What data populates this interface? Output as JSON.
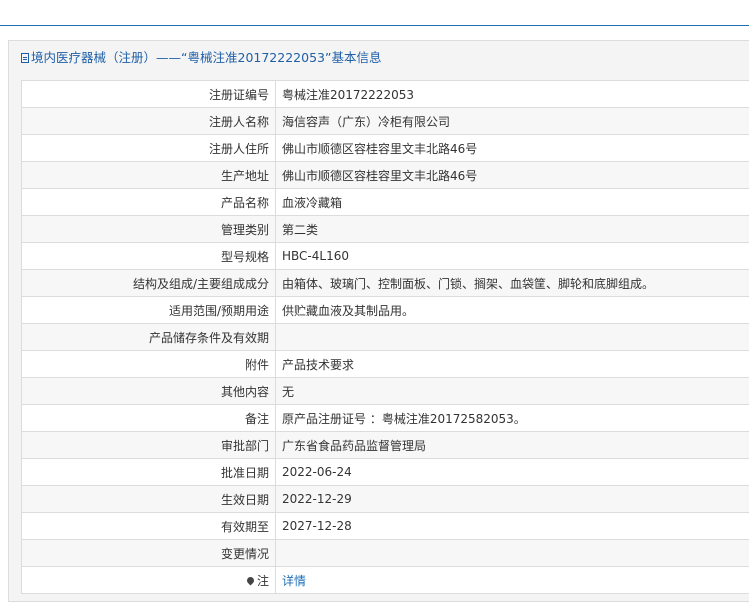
{
  "header": {
    "title_prefix": "境内医疗器械（注册）——",
    "title_main": "“粤械注准20172222053”基本信息"
  },
  "rows": [
    {
      "label": "注册证编号",
      "value": "粤械注准20172222053"
    },
    {
      "label": "注册人名称",
      "value": "海信容声（广东）冷柜有限公司"
    },
    {
      "label": "注册人住所",
      "value": "佛山市顺德区容桂容里文丰北路46号"
    },
    {
      "label": "生产地址",
      "value": "佛山市顺德区容桂容里文丰北路46号"
    },
    {
      "label": "产品名称",
      "value": "血液冷藏箱"
    },
    {
      "label": "管理类别",
      "value": "第二类"
    },
    {
      "label": "型号规格",
      "value": "HBC-4L160"
    },
    {
      "label": "结构及组成/主要组成成分",
      "value": "由箱体、玻璃门、控制面板、门锁、搁架、血袋筐、脚轮和底脚组成。"
    },
    {
      "label": "适用范围/预期用途",
      "value": "供贮藏血液及其制品用。"
    },
    {
      "label": "产品储存条件及有效期",
      "value": ""
    },
    {
      "label": "附件",
      "value": "产品技术要求"
    },
    {
      "label": "其他内容",
      "value": "无"
    },
    {
      "label": "备注",
      "value": "原产品注册证号 ：粤械注准20172582053。"
    },
    {
      "label": "审批部门",
      "value": "广东省食品药品监督管理局"
    },
    {
      "label": "批准日期",
      "value": "2022-06-24"
    },
    {
      "label": "生效日期",
      "value": "2022-12-29"
    },
    {
      "label": "有效期至",
      "value": "2027-12-28"
    },
    {
      "label": "变更情况",
      "value": ""
    }
  ],
  "note_row": {
    "label": "注",
    "link": "详情",
    "icon": "pin-icon"
  }
}
